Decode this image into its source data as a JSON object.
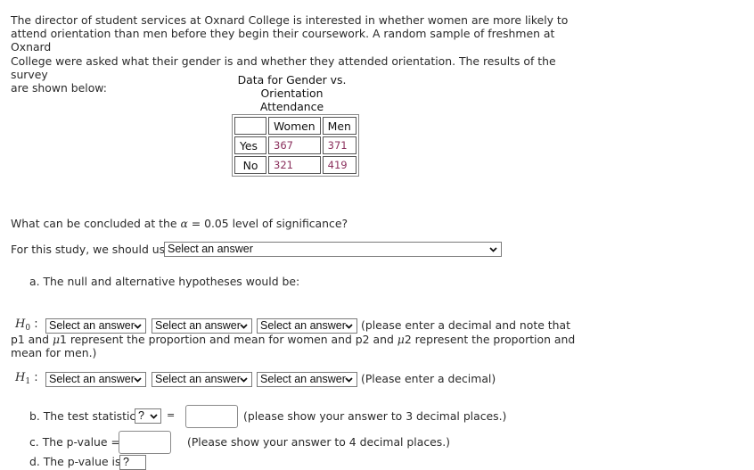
{
  "intro": {
    "lines": [
      "The director of student services at Oxnard College is interested in whether women are more likely to",
      "attend orientation than men before they begin their coursework.  A random sample of freshmen at Oxnard",
      "College were asked what their gender is and whether they attended orientation.  The results of the survey",
      "are shown below:"
    ]
  },
  "table": {
    "caption_lines": [
      "Data for Gender vs.",
      "Orientation",
      "Attendance"
    ],
    "columns": [
      "",
      "Women",
      "Men"
    ],
    "rows": [
      {
        "label": "Yes",
        "women": "367",
        "men": "371"
      },
      {
        "label": "No",
        "women": "321",
        "men": "419"
      }
    ]
  },
  "question": {
    "prefix": "What can be concluded at the ",
    "alpha_symbol": "α",
    "suffix": " = 0.05 level of significance?"
  },
  "study": {
    "label": "For this study, we should use",
    "select_value": "Select an answer"
  },
  "part_a": {
    "label": "a. The null and alternative hypotheses would be:",
    "h0_label": "H",
    "h0_sub": "0",
    "h1_label": "H",
    "h1_sub": "1",
    "colon": ":",
    "h0_selects": [
      "Select an answer",
      "Select an answer",
      "Select an answer"
    ],
    "h1_selects": [
      "Select an answer",
      "Select an answer",
      "Select an answer"
    ],
    "h0_note_line1": "(please enter a decimal and note that",
    "h0_note_line2_a": "p1 and ",
    "mu": "μ",
    "h0_note_line2_b": "1 represent the proportion and mean for women and p2 and ",
    "h0_note_line2_c": "2 represent the proportion and",
    "h0_note_line3": "mean for men.)",
    "h1_note": "(Please enter a decimal)"
  },
  "part_b": {
    "label": "b. The test statistic",
    "select_value": "?",
    "equals": "=",
    "input_value": "",
    "note": "(please show your answer to 3 decimal places.)"
  },
  "part_c": {
    "label": "c. The p-value =",
    "input_value": "",
    "note": "(Please show your answer to 4 decimal places.)"
  },
  "part_d": {
    "label": "d. The p-value is",
    "select_value": "?"
  }
}
